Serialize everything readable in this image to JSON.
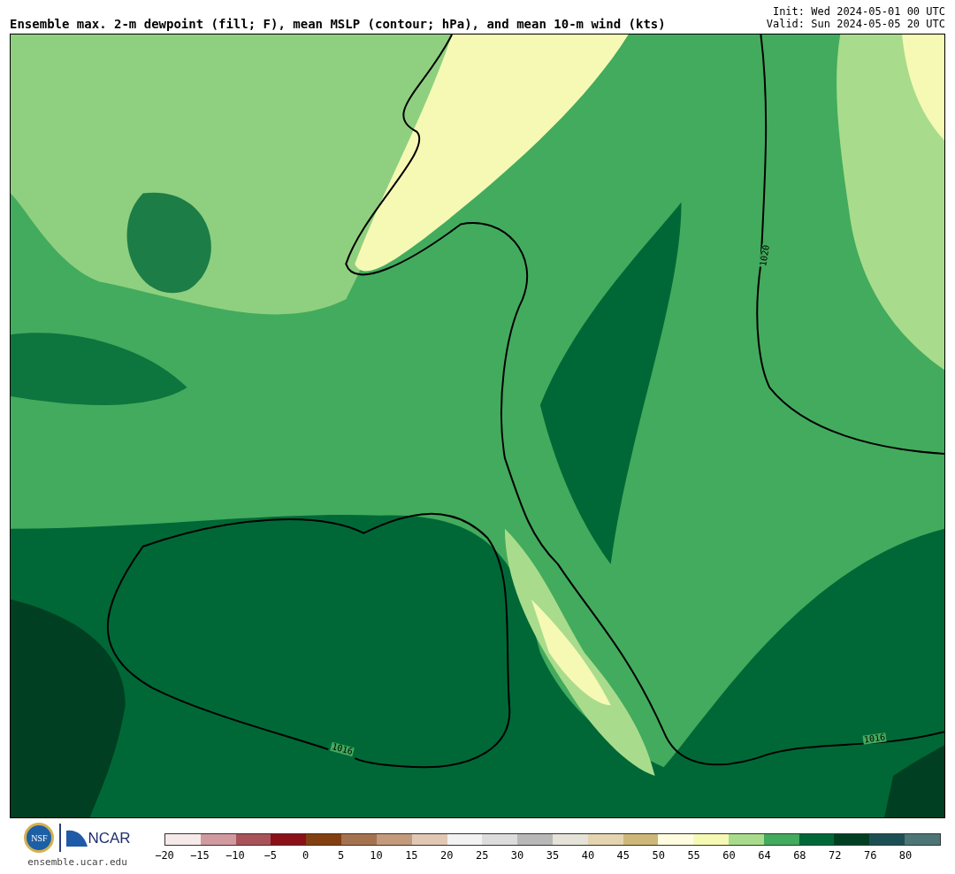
{
  "title": "Ensemble max. 2-m dewpoint (fill; F), mean MSLP (contour; hPa), and mean 10-m wind (kts)",
  "init": "Init: Wed 2024-05-01 00 UTC",
  "valid": "Valid: Sun 2024-05-05 20 UTC",
  "map": {
    "contour_labels": [
      {
        "text": "1020",
        "kind": "vertical"
      },
      {
        "text": "1016",
        "kind": "gulf"
      },
      {
        "text": "1016",
        "kind": "atlantic"
      }
    ]
  },
  "logos": {
    "nsf": "NSF",
    "ncar": "NCAR",
    "site": "ensemble.ucar.edu"
  },
  "colorbar": {
    "segments": [
      {
        "color": "#f5e9e9"
      },
      {
        "color": "#d09a9e"
      },
      {
        "color": "#a8525a"
      },
      {
        "color": "#8b1018"
      },
      {
        "color": "#843f10"
      },
      {
        "color": "#a5724f"
      },
      {
        "color": "#c39a7c"
      },
      {
        "color": "#e0c8b5"
      },
      {
        "color": "#f2f2f2"
      },
      {
        "color": "#dcdcdc"
      },
      {
        "color": "#b8b8b8"
      },
      {
        "color": "#e5e3d8"
      },
      {
        "color": "#e4d4b0"
      },
      {
        "color": "#cdb87a"
      },
      {
        "color": "#fffde0"
      },
      {
        "color": "#f6f9b4"
      },
      {
        "color": "#a8dc8c"
      },
      {
        "color": "#43ab5d"
      },
      {
        "color": "#006837"
      },
      {
        "color": "#003f22"
      },
      {
        "color": "#1c4f53"
      },
      {
        "color": "#4c7676"
      }
    ],
    "ticks": [
      "−20",
      "−15",
      "−10",
      "−5",
      "0",
      "5",
      "10",
      "15",
      "20",
      "25",
      "30",
      "35",
      "40",
      "45",
      "50",
      "55",
      "60",
      "64",
      "68",
      "72",
      "76",
      "80"
    ]
  }
}
